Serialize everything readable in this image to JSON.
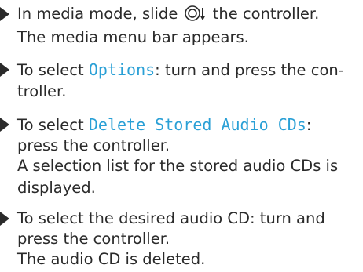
{
  "steps": [
    {
      "bullet": true,
      "segments": [
        {
          "text": "In media mode, slide "
        },
        {
          "icon": "controller-slide-down-icon"
        },
        {
          "text": " the controller."
        }
      ]
    },
    {
      "bullet": false,
      "segments": [
        {
          "text": "The media menu bar appears."
        }
      ]
    },
    {
      "bullet": true,
      "segments": [
        {
          "text": "To select "
        },
        {
          "text": "Options",
          "highlight": true
        },
        {
          "text": ": turn and press the con-"
        }
      ]
    },
    {
      "bullet": false,
      "segments": [
        {
          "text": "troller."
        }
      ]
    },
    {
      "bullet": true,
      "segments": [
        {
          "text": "To select "
        },
        {
          "text": "Delete Stored Audio CDs",
          "highlight": true
        },
        {
          "text": ":"
        }
      ]
    },
    {
      "bullet": false,
      "segments": [
        {
          "text": "press the controller."
        }
      ]
    },
    {
      "bullet": false,
      "segments": [
        {
          "text": "A selection list for the stored audio CDs is"
        }
      ]
    },
    {
      "bullet": false,
      "segments": [
        {
          "text": "displayed."
        }
      ]
    },
    {
      "bullet": true,
      "segments": [
        {
          "text": "To select the desired audio CD: turn and"
        }
      ]
    },
    {
      "bullet": false,
      "segments": [
        {
          "text": "press the controller."
        }
      ]
    },
    {
      "bullet": false,
      "segments": [
        {
          "text": "The audio CD is deleted."
        }
      ]
    }
  ],
  "colors": {
    "text": "#2a2a2a",
    "highlight": "#2aa0d6"
  }
}
